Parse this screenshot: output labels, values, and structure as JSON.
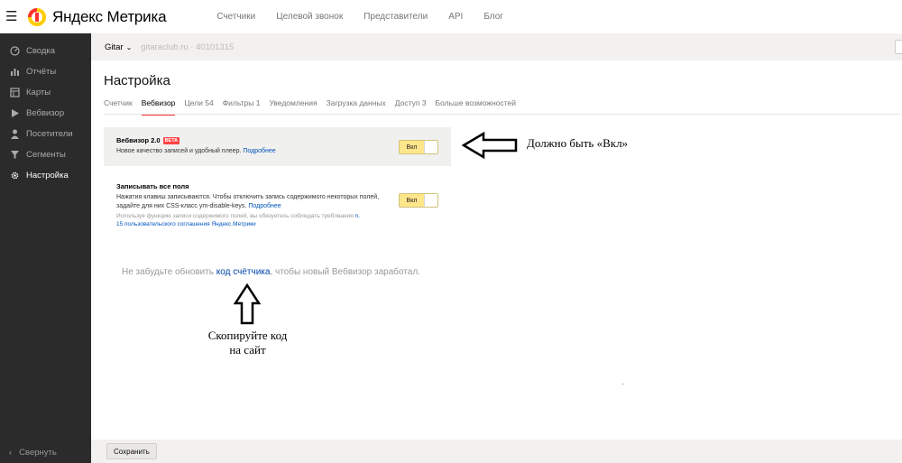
{
  "topbar": {
    "logo_text": "Яндекс Метрика",
    "nav": [
      "Счетчики",
      "Целевой звонок",
      "Представители",
      "API",
      "Блог"
    ]
  },
  "sidebar": {
    "items": [
      {
        "label": "Сводка",
        "icon": "dashboard-icon"
      },
      {
        "label": "Отчёты",
        "icon": "reports-icon"
      },
      {
        "label": "Карты",
        "icon": "maps-icon"
      },
      {
        "label": "Вебвизор",
        "icon": "play-icon"
      },
      {
        "label": "Посетители",
        "icon": "visitors-icon"
      },
      {
        "label": "Сегменты",
        "icon": "filter-icon"
      },
      {
        "label": "Настройка",
        "icon": "gear-icon"
      }
    ],
    "active_index": 6,
    "collapse_label": "Свернуть"
  },
  "counter": {
    "name": "Gitar",
    "site": "gitaraclub.ru · 40101315"
  },
  "page": {
    "title": "Настройка",
    "tabs": [
      "Счетчик",
      "Вебвизор",
      "Цели 54",
      "Фильтры 1",
      "Уведомления",
      "Загрузка данных",
      "Доступ 3",
      "Больше возможностей"
    ],
    "active_tab": 1
  },
  "webvisor": {
    "title": "Вебвизор 2.0",
    "badge": "BETA",
    "desc": "Новое качество записей и удобный плеер.",
    "link": "Подробнее",
    "toggle_label": "Вкл"
  },
  "fields": {
    "title": "Записывать все поля",
    "desc": "Нажатия клавиш записываются. Чтобы отключить запись содержимого некоторых полей, задайте для них CSS-класс ym-disable-keys.",
    "link": "Подробнее",
    "note": "Используя функцию записи содержимого полей, вы обязуетесь соблюдать требования",
    "note_link": "п. 15 пользовательского соглашения Яндекс.Метрики",
    "toggle_label": "Вкл"
  },
  "reminder": {
    "before": "Не забудьте обновить ",
    "link": "код счётчика",
    "after": ", чтобы новый Вебвизор заработал."
  },
  "footer": {
    "save_label": "Сохранить"
  },
  "annotations": {
    "right": "Должно быть «Вкл»",
    "bottom_line1": "Скопируйте код",
    "bottom_line2": "на сайт"
  },
  "colors": {
    "accent_red": "#ff3333",
    "toggle_on": "#ffe68a",
    "link": "#0055bb",
    "sidebar_bg": "#2b2b2b"
  }
}
